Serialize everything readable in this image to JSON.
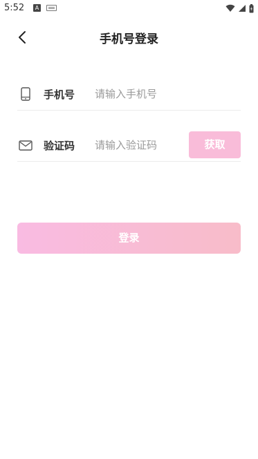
{
  "status_bar": {
    "time": "5:52",
    "notification_letter": "A",
    "icons": [
      "wifi-icon",
      "signal-icon",
      "battery-icon"
    ]
  },
  "header": {
    "title": "手机号登录",
    "back_icon": "chevron-left-icon"
  },
  "form": {
    "phone": {
      "icon": "phone-icon",
      "label": "手机号",
      "placeholder": "请输入手机号",
      "value": ""
    },
    "code": {
      "icon": "mail-icon",
      "label": "验证码",
      "placeholder": "请输入验证码",
      "value": "",
      "get_code_label": "获取"
    }
  },
  "login_button_label": "登录",
  "colors": {
    "accent_pink": "#f9bcd9",
    "gradient_start": "#f9bbe2",
    "gradient_end": "#f8bcc9"
  }
}
